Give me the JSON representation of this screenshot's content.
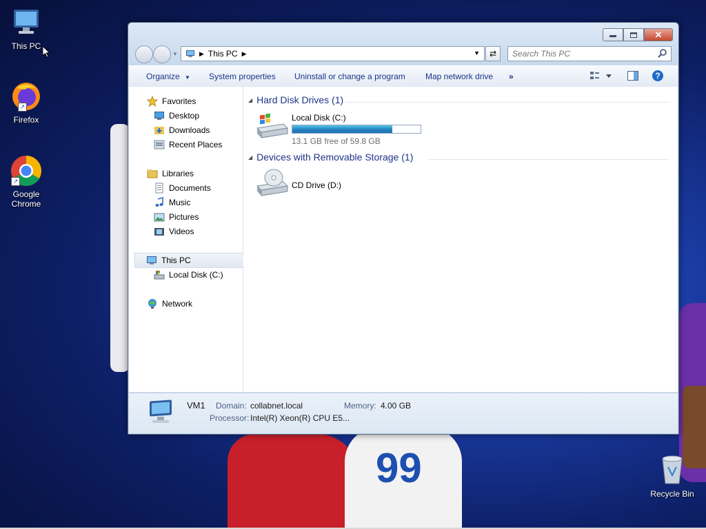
{
  "desktop": {
    "icons": [
      {
        "label": "This PC",
        "icon": "this-pc-icon"
      },
      {
        "label": "Firefox",
        "icon": "firefox-icon"
      },
      {
        "label": "Google Chrome",
        "icon": "chrome-icon"
      },
      {
        "label": "Recycle Bin",
        "icon": "recycle-bin-icon"
      }
    ],
    "background_number": "99"
  },
  "window": {
    "address": {
      "location": "This PC"
    },
    "search": {
      "placeholder": "Search This PC"
    },
    "commands": {
      "organize": "Organize",
      "system_properties": "System properties",
      "uninstall": "Uninstall or change a program",
      "map_network_drive": "Map network drive",
      "more": "»"
    },
    "nav": {
      "favorites": "Favorites",
      "desktop": "Desktop",
      "downloads": "Downloads",
      "recent_places": "Recent Places",
      "libraries": "Libraries",
      "documents": "Documents",
      "music": "Music",
      "pictures": "Pictures",
      "videos": "Videos",
      "this_pc": "This PC",
      "local_disk": "Local Disk (C:)",
      "network": "Network"
    },
    "groups": {
      "hard_disk": "Hard Disk Drives (1)",
      "removable": "Devices with Removable Storage (1)"
    },
    "drives": {
      "local_disk": {
        "name": "Local Disk (C:)",
        "free": "13.1 GB free of 59.8 GB",
        "used_fraction": 0.78
      },
      "cd_drive": {
        "name": "CD Drive (D:)"
      }
    },
    "details": {
      "computer": "VM1",
      "domain_label": "Domain:",
      "domain": "collabnet.local",
      "memory_label": "Memory:",
      "memory": "4.00 GB",
      "processor_label": "Processor:",
      "processor": "Intel(R) Xeon(R) CPU E5..."
    }
  }
}
